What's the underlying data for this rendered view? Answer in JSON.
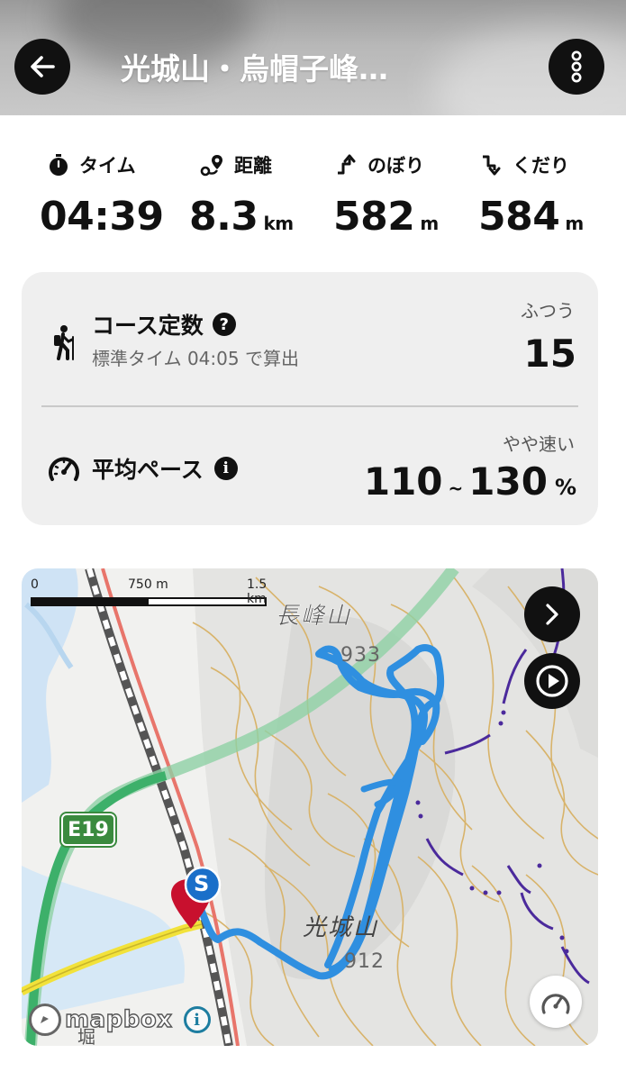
{
  "header": {
    "title": "光城山・烏帽子峰…"
  },
  "stats": [
    {
      "label": "タイム",
      "value": "04:39",
      "unit": ""
    },
    {
      "label": "距離",
      "value": "8.3",
      "unit": "km"
    },
    {
      "label": "のぼり",
      "value": "582",
      "unit": "m"
    },
    {
      "label": "くだり",
      "value": "584",
      "unit": "m"
    }
  ],
  "course": {
    "title": "コース定数",
    "subtitle": "標準タイム 04:05 で算出",
    "level": "ふつう",
    "value": "15"
  },
  "pace": {
    "title": "平均ペース",
    "level": "やや速い",
    "min": "110",
    "tilde": "~",
    "max": "130",
    "unit": "%"
  },
  "map": {
    "scale_ticks": [
      "0",
      "750 m",
      "1.5 km"
    ],
    "labels": {
      "peak1": "長峰山",
      "elev1": "933",
      "peak2": "光城山",
      "elev2": "912",
      "road": "E19",
      "start": "S",
      "place": "堀"
    },
    "attribution": "mapbox",
    "colors": {
      "track": "#2f8fe0",
      "marker": "#1a6fc9",
      "highway": "#3db06a",
      "road_yellow": "#f2e23a"
    }
  }
}
